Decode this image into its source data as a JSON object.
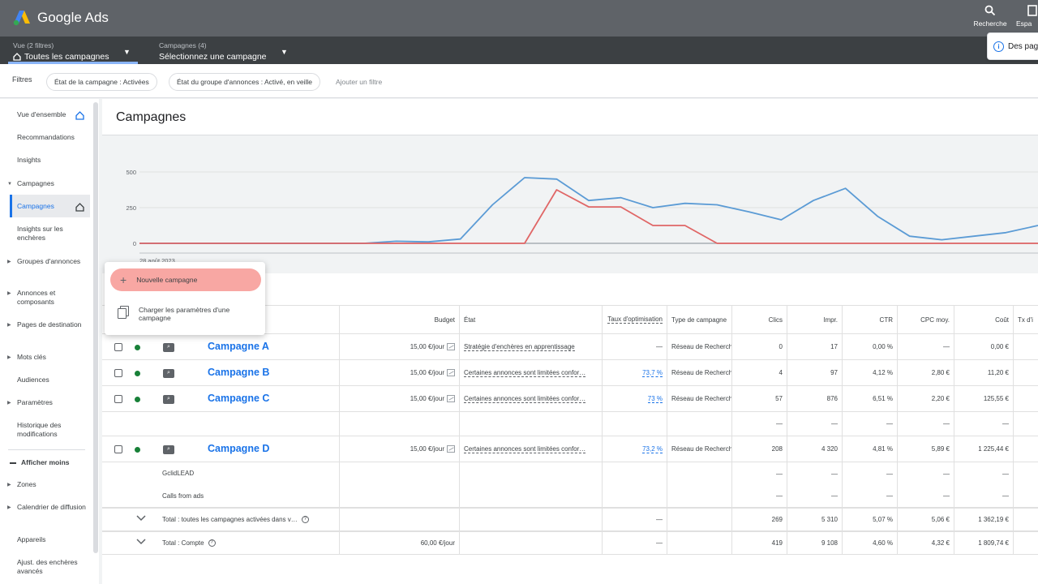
{
  "app": {
    "brand": "Google Ads"
  },
  "topbar": {
    "actions": [
      {
        "label": "Recherche",
        "icon": "search-icon"
      },
      {
        "label": "Espa",
        "icon": "workspace-icon"
      }
    ],
    "notice": "Des pag"
  },
  "subbar": {
    "view": {
      "caption": "Vue (2 filtres)",
      "value": "Toutes les campagnes"
    },
    "campaigns": {
      "caption": "Campagnes (4)",
      "value": "Sélectionnez une campagne"
    }
  },
  "filters": {
    "label": "Filtres",
    "chips": [
      "État de la campagne : Activées",
      "État du groupe d'annonces : Activé, en veille"
    ],
    "add": "Ajouter un filtre"
  },
  "sidebar": {
    "items": [
      {
        "label": "Vue d'ensemble"
      },
      {
        "label": "Recommandations"
      },
      {
        "label": "Insights"
      },
      {
        "label": "Campagnes"
      },
      {
        "label": "Campagnes"
      },
      {
        "label": "Insights sur les enchères"
      },
      {
        "label": "Groupes d'annonces"
      },
      {
        "label": "Annonces et composants"
      },
      {
        "label": "Pages de destination"
      },
      {
        "label": "Mots clés"
      },
      {
        "label": "Audiences"
      },
      {
        "label": "Paramètres"
      },
      {
        "label": "Historique des modifications"
      },
      {
        "label": "Afficher moins"
      },
      {
        "label": "Zones"
      },
      {
        "label": "Calendrier de diffusion"
      },
      {
        "label": "Appareils"
      },
      {
        "label": "Ajust. des enchères avancés"
      }
    ]
  },
  "main": {
    "title": "Campagnes"
  },
  "chart_data": {
    "type": "line",
    "yticks": [
      "500",
      "250",
      "0"
    ],
    "ylim": [
      0,
      500
    ],
    "xlabel_first": "28 août 2023",
    "grid": true,
    "series": [
      {
        "color": "#5b9bd5",
        "values": [
          0,
          0,
          0,
          0,
          0,
          0,
          0,
          0,
          15,
          10,
          30,
          270,
          460,
          450,
          300,
          320,
          250,
          280,
          270,
          220,
          165,
          300,
          385,
          190,
          50,
          25,
          50,
          75,
          125
        ]
      },
      {
        "color": "#e06666",
        "values": [
          0,
          0,
          0,
          0,
          0,
          0,
          0,
          0,
          0,
          0,
          0,
          0,
          0,
          375,
          255,
          255,
          125,
          125,
          0,
          0,
          0,
          0,
          0,
          0,
          0,
          0,
          0,
          0,
          0
        ]
      }
    ]
  },
  "popup": {
    "primary": "Nouvelle campagne",
    "secondary": "Charger les paramètres d'une campagne"
  },
  "table": {
    "headers": {
      "budget": "Budget",
      "etat": "État",
      "taux": "Taux d'optimisation",
      "type": "Type de campagne",
      "clics": "Clics",
      "impr": "Impr.",
      "ctr": "CTR",
      "cpc": "CPC moy.",
      "cout": "Coût",
      "tx": "Tx d'i"
    },
    "rows": [
      {
        "name": "Campagne A",
        "budget": "15,00 €/jour",
        "etat": "Stratégie d'enchères en apprentissage",
        "taux": "—",
        "type": "Réseau de Recherch",
        "clics": "0",
        "impr": "17",
        "ctr": "0,00 %",
        "cpc": "—",
        "cout": "0,00 €"
      },
      {
        "name": "Campagne B",
        "budget": "15,00 €/jour",
        "etat": "Certaines annonces sont limitées confor…",
        "taux": "73,7 %",
        "type": "Réseau de Recherch",
        "clics": "4",
        "impr": "97",
        "ctr": "4,12 %",
        "cpc": "2,80 €",
        "cout": "11,20 €"
      },
      {
        "name": "Campagne C",
        "budget": "15,00 €/jour",
        "etat": "Certaines annonces sont limitées confor…",
        "taux": "73 %",
        "type": "Réseau de Recherch",
        "clics": "57",
        "impr": "876",
        "ctr": "6,51 %",
        "cpc": "2,20 €",
        "cout": "125,55 €"
      },
      {
        "name": "",
        "budget": "",
        "etat": "",
        "taux": "",
        "type": "",
        "clics": "—",
        "impr": "—",
        "ctr": "—",
        "cpc": "—",
        "cout": "—"
      },
      {
        "name": "Campagne D",
        "budget": "15,00 €/jour",
        "etat": "Certaines annonces sont limitées confor…",
        "taux": "73,2 %",
        "type": "Réseau de Recherch",
        "clics": "208",
        "impr": "4 320",
        "ctr": "4,81 %",
        "cpc": "5,89 €",
        "cout": "1 225,44 €"
      }
    ],
    "conversions": [
      {
        "label": "GclidLEAD",
        "clics": "—",
        "impr": "—",
        "ctr": "—",
        "cpc": "—",
        "cout": "—"
      },
      {
        "label": "Calls from ads",
        "clics": "—",
        "impr": "—",
        "ctr": "—",
        "cpc": "—",
        "cout": "—"
      }
    ],
    "totals": [
      {
        "label": "Total : toutes les campagnes activées dans v…",
        "budget": "",
        "taux": "—",
        "clics": "269",
        "impr": "5 310",
        "ctr": "5,07 %",
        "cpc": "5,06 €",
        "cout": "1 362,19 €"
      },
      {
        "label": "Total : Compte",
        "budget": "60,00 €/jour",
        "taux": "—",
        "clics": "419",
        "impr": "9 108",
        "ctr": "4,60 %",
        "cpc": "4,32 €",
        "cout": "1 809,74 €"
      }
    ]
  }
}
